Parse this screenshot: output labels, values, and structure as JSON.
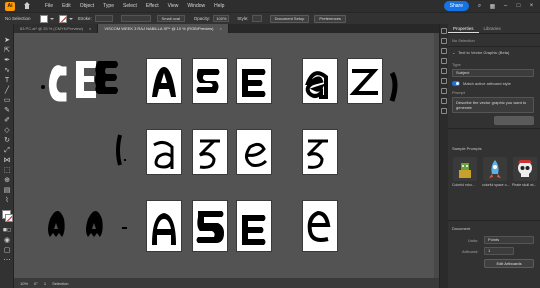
{
  "app": {
    "logo_text": "Ai"
  },
  "menu": [
    "File",
    "Edit",
    "Object",
    "Type",
    "Select",
    "Effect",
    "View",
    "Window",
    "Help"
  ],
  "menubar_right": {
    "share_label": "Share"
  },
  "controlbar": {
    "selection_label": "No Selection",
    "stroke_label": "Stroke:",
    "brush_value": "Small oval",
    "opacity_label": "Opacity:",
    "opacity_value": "100%",
    "style_label": "Style:",
    "document_setup_label": "Document Setup",
    "preferences_label": "Preferences"
  },
  "tabs": [
    {
      "label": "83 PC.ai* @ 25 % (CMYK/Preview)",
      "close": "×"
    },
    {
      "label": "VISCOM WEEK 3 RAJ NABILLA SP* @ 10 % (RGB/Preview)",
      "close": "×"
    }
  ],
  "status": {
    "zoom": "10%",
    "angle": "0°",
    "artboard": "1",
    "tool": "Selection"
  },
  "panel": {
    "tabs": [
      "Properties",
      "Libraries"
    ],
    "no_selection": "No Selection",
    "text_to_vector": "Text to Vector Graphic (Beta)",
    "type_label": "Type",
    "type_value": "Subject",
    "match_style_label": "Match active artboard style",
    "prompt_label": "Prompt",
    "prompt_value": "Describe the vector graphic you want to generate",
    "sample_prompts_label": "Sample Prompts",
    "sample_prompts": [
      "Colorful robo...",
      "colorful space o...",
      "Pirate skull wi..."
    ],
    "document_label": "Document",
    "units_label": "Units:",
    "units_value": "Points",
    "artboard_label": "Artboard:",
    "artboard_value": "1",
    "edit_artboards_label": "Edit Artboards"
  },
  "colors": {
    "accent": "#1473e6",
    "app_bg": "#2b2b2b",
    "canvas_bg": "#535353",
    "logo": "#ff9a00"
  }
}
